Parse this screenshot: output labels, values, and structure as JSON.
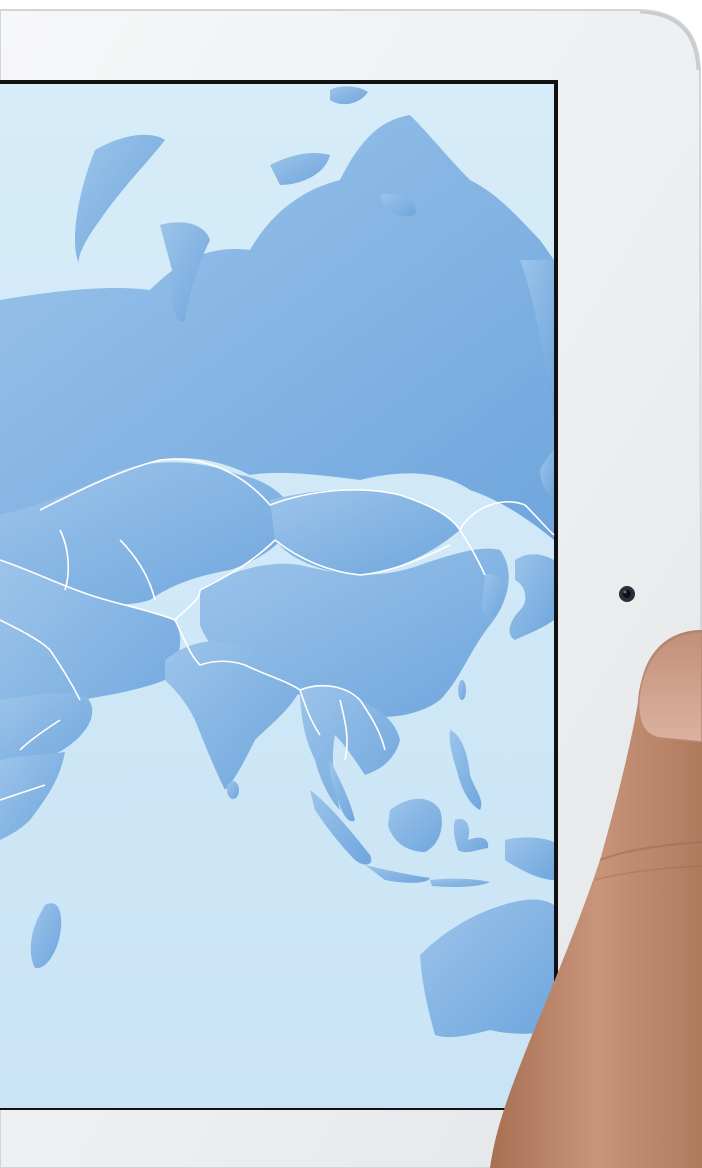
{
  "scene": {
    "description_name": "ipad-landscape-world-map",
    "device_color": "silver-white",
    "screen_content": "world-map-asia-oceania",
    "colors": {
      "bezel": "#eef0f1",
      "bezel_edge": "#d7dadc",
      "ocean": "#cfe8f7",
      "land": "#8bb8e3",
      "land_dark": "#7aaadc",
      "border": "#ffffff",
      "camera": "#1b1f27",
      "skin": "#c48d6c"
    },
    "icons": [
      "front-camera-icon"
    ]
  }
}
